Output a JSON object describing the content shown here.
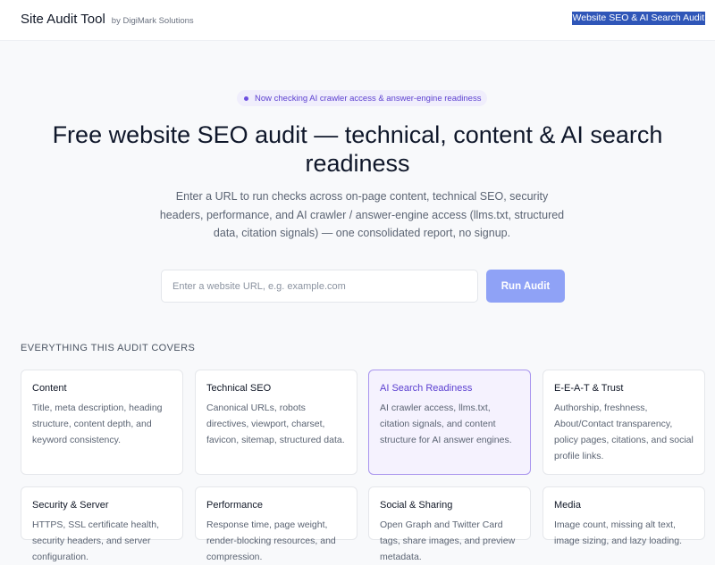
{
  "header": {
    "title": "Site Audit Tool",
    "subtitle": "by DigiMark Solutions",
    "link_text": "Website SEO & AI Search Audit"
  },
  "hero": {
    "badge": "Now checking AI crawler access & answer-engine readiness",
    "title": "Free website SEO audit — technical, content & AI search readiness",
    "description": "Enter a URL to run checks across on-page content, technical SEO, security headers, performance, and AI crawler / answer-engine access (llms.txt, structured data, citation signals) — one consolidated report, no signup."
  },
  "form": {
    "url_placeholder": "Enter a website URL, e.g. example.com",
    "url_value": "",
    "submit_label": "Run Audit"
  },
  "covers": {
    "label": "EVERYTHING THIS AUDIT COVERS",
    "cards": [
      {
        "title": "Content",
        "desc": "Title, meta description, heading structure, content depth, and keyword consistency."
      },
      {
        "title": "Technical SEO",
        "desc": "Canonical URLs, robots directives, viewport, charset, favicon, sitemap, structured data."
      },
      {
        "title": "AI Search Readiness",
        "desc": "AI crawler access, llms.txt, citation signals, and content structure for AI answer engines."
      },
      {
        "title": "E-E-A-T & Trust",
        "desc": "Authorship, freshness, About/Contact transparency, policy pages, citations, and social profile links."
      },
      {
        "title": "Security & Server",
        "desc": "HTTPS, SSL certificate health, security headers, and server configuration."
      },
      {
        "title": "Performance",
        "desc": "Response time, page weight, render-blocking resources, and compression."
      },
      {
        "title": "Social & Sharing",
        "desc": "Open Graph and Twitter Card tags, share images, and preview metadata."
      },
      {
        "title": "Media",
        "desc": "Image count, missing alt text, image sizing, and lazy loading."
      }
    ]
  },
  "colors": {
    "accent": "#5b3fd0",
    "button": "#8fa2f6",
    "highlight_bg": "#f5f2fe",
    "highlight_border": "#a995ee"
  }
}
